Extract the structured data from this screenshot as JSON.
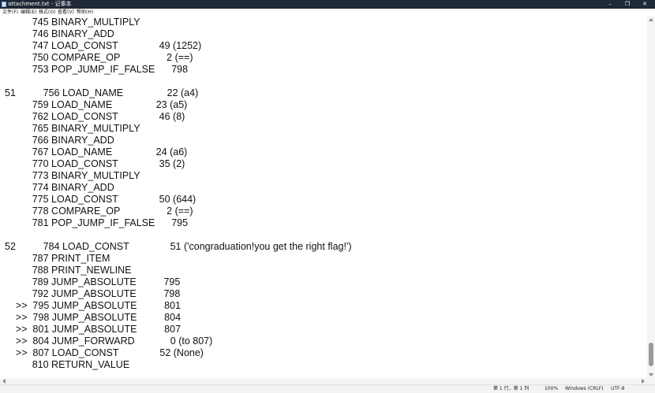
{
  "window": {
    "title": "attachment.txt - 记事本",
    "minimize": "–",
    "maximize": "❐",
    "close": "✕"
  },
  "menu": [
    "文件(F)",
    "编辑(E)",
    "格式(O)",
    "查看(V)",
    "帮助(H)"
  ],
  "lines": [
    "          745 BINARY_MULTIPLY",
    "          746 BINARY_ADD",
    "          747 LOAD_CONST               49 (1252)",
    "          750 COMPARE_OP                 2 (==)",
    "          753 POP_JUMP_IF_FALSE      798",
    "",
    "51          756 LOAD_NAME                22 (a4)",
    "          759 LOAD_NAME                23 (a5)",
    "          762 LOAD_CONST               46 (8)",
    "          765 BINARY_MULTIPLY",
    "          766 BINARY_ADD",
    "          767 LOAD_NAME                24 (a6)",
    "          770 LOAD_CONST               35 (2)",
    "          773 BINARY_MULTIPLY",
    "          774 BINARY_ADD",
    "          775 LOAD_CONST               50 (644)",
    "          778 COMPARE_OP                 2 (==)",
    "          781 POP_JUMP_IF_FALSE      795",
    "",
    "52          784 LOAD_CONST               51 ('congraduation!you get the right flag!')",
    "          787 PRINT_ITEM",
    "          788 PRINT_NEWLINE",
    "          789 JUMP_ABSOLUTE          795",
    "          792 JUMP_ABSOLUTE          798",
    "    >>  795 JUMP_ABSOLUTE          801",
    "    >>  798 JUMP_ABSOLUTE          804",
    "    >>  801 JUMP_ABSOLUTE          807",
    "    >>  804 JUMP_FORWARD             0 (to 807)",
    "    >>  807 LOAD_CONST               52 (None)",
    "          810 RETURN_VALUE"
  ],
  "status": {
    "position": "第 1 行，第 1 列",
    "zoom": "100%",
    "line_ending": "Windows (CRLF)",
    "encoding": "UTF-8"
  }
}
